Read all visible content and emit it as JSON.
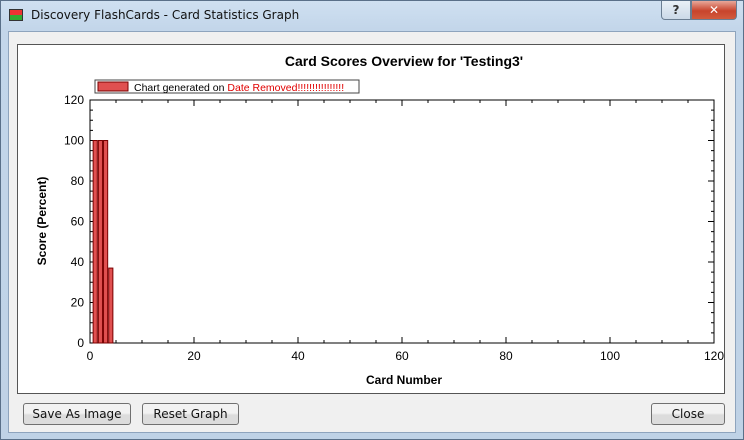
{
  "window": {
    "title": "Discovery FlashCards - Card Statistics Graph",
    "help_label": "?",
    "close_label": "✕"
  },
  "chart_data": {
    "type": "bar",
    "title": "Card Scores Overview for 'Testing3'",
    "xlabel": "Card Number",
    "ylabel": "Score (Percent)",
    "xlim": [
      0,
      120
    ],
    "ylim": [
      0,
      120
    ],
    "xticks": [
      0,
      20,
      40,
      60,
      80,
      100,
      120
    ],
    "yticks": [
      0,
      20,
      40,
      60,
      80,
      100,
      120
    ],
    "x": [
      1,
      2,
      3,
      4
    ],
    "values": [
      100,
      100,
      100,
      37
    ],
    "legend": {
      "prefix": "Chart generated on ",
      "highlight": "Date Removed!!!!!!!!!!!!!!!!",
      "position": "top-left"
    },
    "colors": {
      "bar_fill": "#e05050",
      "bar_edge": "#7a0000",
      "legend_highlight": "#e00000"
    }
  },
  "buttons": {
    "save_image": "Save As Image",
    "reset_graph": "Reset Graph",
    "close": "Close"
  }
}
